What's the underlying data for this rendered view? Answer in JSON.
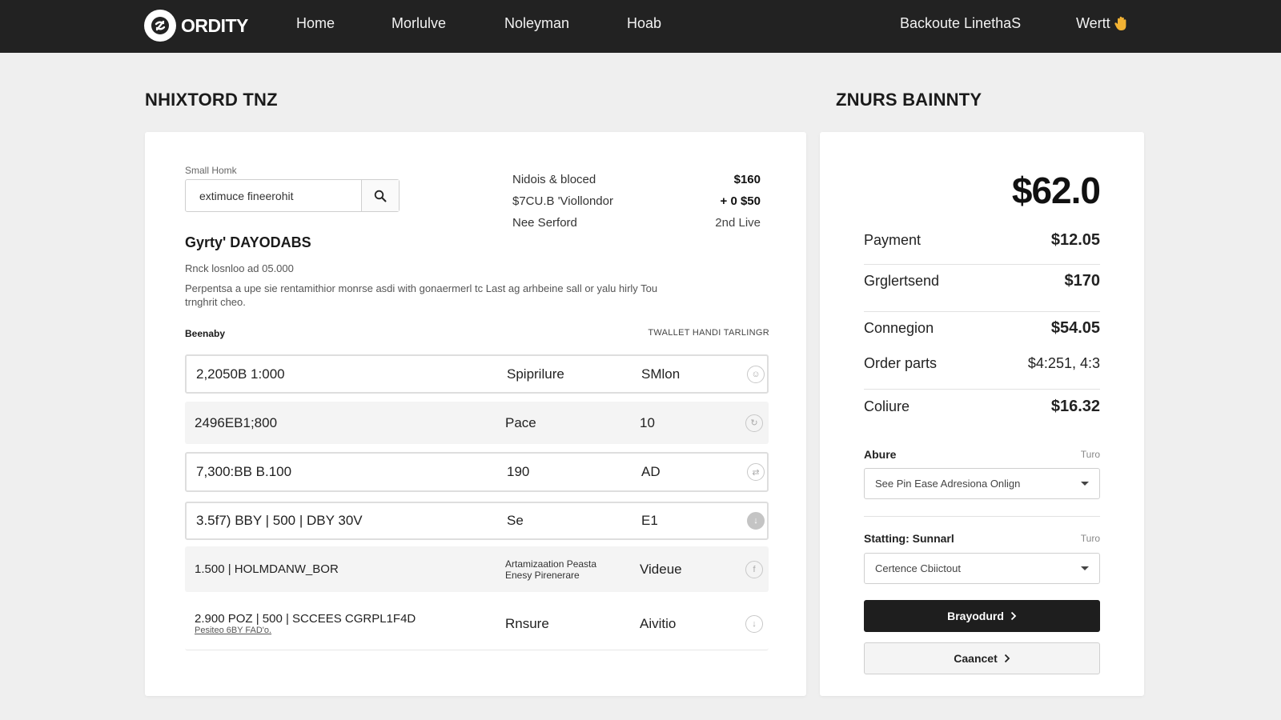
{
  "nav": {
    "logo_text": "ORDITY",
    "links": [
      "Home",
      "Morlulve",
      "Noleyman",
      "Hoab"
    ],
    "right_link": "Backoute LinethaS",
    "user_label": "Wertt"
  },
  "left": {
    "title": "NHIXTORD TNZ",
    "search": {
      "label": "Small Homk",
      "value": "extimuce fineerohit"
    },
    "summary": [
      {
        "label": "Nidois & bloced",
        "value": "$160"
      },
      {
        "label": "$7CU.B 'Viollondor",
        "value": "+ 0 $50"
      },
      {
        "label": "Nee Serford",
        "value": "2nd Live"
      }
    ],
    "sub_heading": "Gyrty' DAYODABS",
    "meta": "Rnck losnloo ad 05.000",
    "description": "Perpentsa a upe sie rentamithior monrse asdi with gonaermerl tc Last ag arhbeine sall or yalu hirly Tou trnghrit cheo.",
    "list_header_left": "Beenaby",
    "list_header_right": "TWALLET HANDI TARLINGR",
    "rows": [
      {
        "c1": "2,2050B 1:000",
        "c2": "Spiprilure",
        "c3": "SMlon",
        "icon": "smile-icon"
      },
      {
        "c1": "2496EB1;800",
        "c2": "Pace",
        "c3": "10",
        "icon": "refresh-icon"
      },
      {
        "c1": "7,300:BB B.100",
        "c2": "190",
        "c3": "AD",
        "icon": "sync-icon"
      },
      {
        "c1": "3.5f7) BBY | 500 | DBY 30V",
        "c2": "Se",
        "c3": "E1",
        "icon": "download-icon"
      },
      {
        "c1": "1.500 | HOLMDANW_BOR",
        "c2": "Artamizaation Peasta Enesy Pirenerare",
        "c3": "Videue",
        "icon": "facebook-icon"
      },
      {
        "c1": "2.900 POZ | 500 | SCCEES CGRPL1F4D",
        "c1_sub": "Pesiteo 6BY FAD'o.",
        "c2": "Rnsure",
        "c3": "Aivitio",
        "icon": "arrow-down-icon"
      }
    ]
  },
  "right": {
    "title": "ZNURS BAINNTY",
    "total": "$62.0",
    "items": [
      {
        "label": "Payment",
        "value": "$12.05"
      },
      {
        "label": "Grglertsend",
        "value": "$170"
      },
      {
        "label": "Connegion",
        "value": "$54.05"
      },
      {
        "label": "Order parts",
        "value": "$4:251, 4:3"
      },
      {
        "label": "Coliure",
        "value": "$16.32"
      }
    ],
    "select1": {
      "label": "Abure",
      "hint": "Turo",
      "value": "See Pin Ease Adresiona Onlign"
    },
    "select2": {
      "label": "Statting: Sunnarl",
      "hint": "Turo",
      "value": "Certence Cbiictout"
    },
    "primary_button": "Brayodurd",
    "secondary_button": "Caancet"
  },
  "colors": {
    "nav_bg": "#222222",
    "page_bg": "#efefef",
    "primary_button": "#1e1e1e",
    "accent_hand": "#f2b233"
  }
}
